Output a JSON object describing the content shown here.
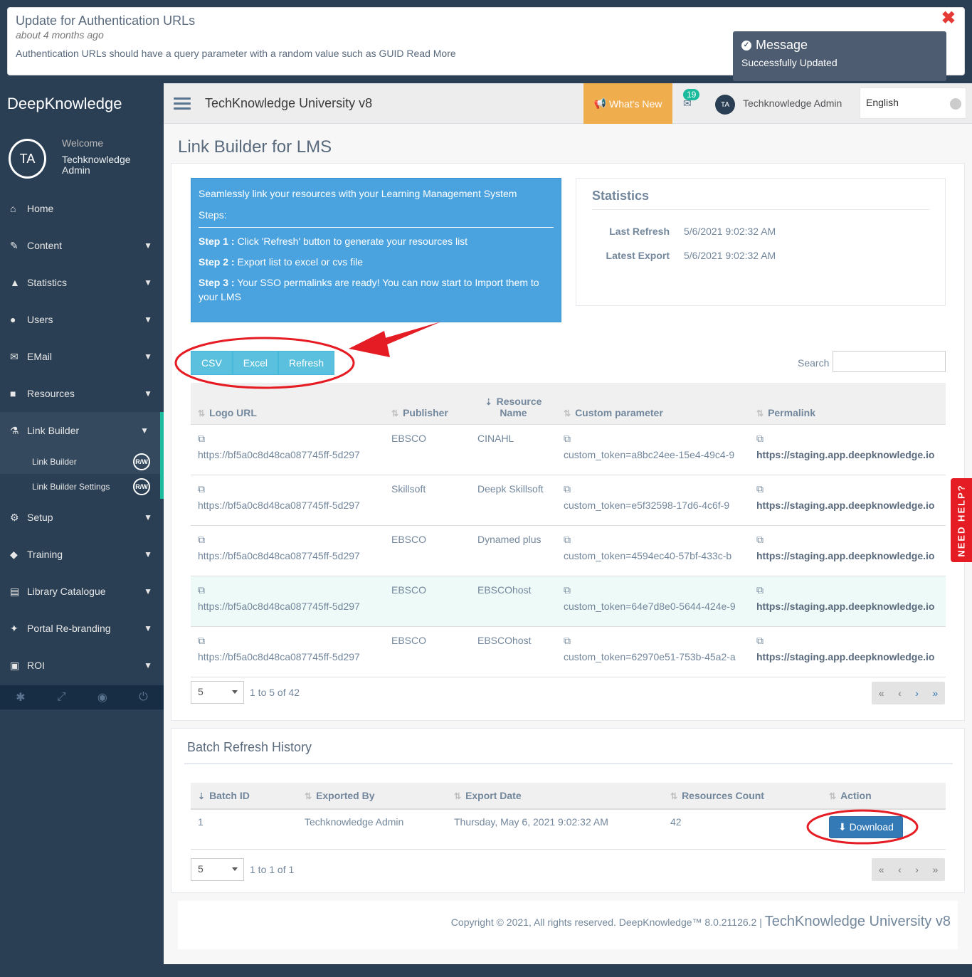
{
  "notification": {
    "title": "Update for Authentication URLs",
    "time": "about 4 months ago",
    "body": "Authentication URLs should have a query parameter with a random value such as GUID Read More"
  },
  "toast": {
    "title": "Message",
    "body": "Successfully Updated"
  },
  "sidebar": {
    "brand": "DeepKnowledge",
    "avatar": "TA",
    "welcome": "Welcome",
    "user_name": "Techknowledge Admin",
    "items": [
      {
        "label": "Home",
        "icon": "home-icon"
      },
      {
        "label": "Content",
        "icon": "edit-icon"
      },
      {
        "label": "Statistics",
        "icon": "area-chart-icon"
      },
      {
        "label": "Users",
        "icon": "users-icon"
      },
      {
        "label": "EMail",
        "icon": "envelope-icon"
      },
      {
        "label": "Resources",
        "icon": "sitemap-icon"
      },
      {
        "label": "Link Builder",
        "icon": "flask-icon"
      },
      {
        "label": "Setup",
        "icon": "cogs-icon"
      },
      {
        "label": "Training",
        "icon": "graduation-cap-icon"
      },
      {
        "label": "Library Catalogue",
        "icon": "book-icon"
      },
      {
        "label": "Portal Re-branding",
        "icon": "magic-icon"
      },
      {
        "label": "ROI",
        "icon": "money-icon"
      }
    ],
    "sub_items": [
      {
        "label": "Link Builder",
        "badge": "R/W"
      },
      {
        "label": "Link Builder Settings",
        "badge": "R/W"
      }
    ]
  },
  "topnav": {
    "title": "TechKnowledge University v8",
    "whats_new": "What's New",
    "mail_count": "19",
    "user_avatar": "TA",
    "user_name": "Techknowledge Admin",
    "language": "English"
  },
  "page": {
    "title": "Link Builder for LMS"
  },
  "infobox": {
    "intro": "Seamlessly link your resources with your Learning Management System",
    "steps_label": "Steps:",
    "step1_label": "Step 1 :",
    "step1": " Click 'Refresh' button to generate your resources list",
    "step2_label": "Step 2 :",
    "step2": " Export list to excel or cvs file",
    "step3_label": "Step 3 :",
    "step3": " Your SSO permalinks are ready! You can now start to Import them to your LMS"
  },
  "statistics": {
    "title": "Statistics",
    "last_refresh_label": "Last Refresh",
    "last_refresh": "5/6/2021 9:02:32 AM",
    "latest_export_label": "Latest Export",
    "latest_export": "5/6/2021 9:02:32 AM"
  },
  "toolbar": {
    "csv": "CSV",
    "excel": "Excel",
    "refresh": "Refresh",
    "search_label": "Search"
  },
  "links_table": {
    "columns": [
      "Logo URL",
      "Publisher",
      "Resource Name",
      "Custom parameter",
      "Permalink"
    ],
    "rows": [
      {
        "logo": "https://bf5a0c8d48ca087745ff-5d297",
        "publisher": "EBSCO",
        "name": "CINAHL",
        "param": "custom_token=a8bc24ee-15e4-49c4-9",
        "permalink": "https://staging.app.deepknowledge.io"
      },
      {
        "logo": "https://bf5a0c8d48ca087745ff-5d297",
        "publisher": "Skillsoft",
        "name": "Deepk Skillsoft",
        "param": "custom_token=e5f32598-17d6-4c6f-9",
        "permalink": "https://staging.app.deepknowledge.io"
      },
      {
        "logo": "https://bf5a0c8d48ca087745ff-5d297",
        "publisher": "EBSCO",
        "name": "Dynamed plus",
        "param": "custom_token=4594ec40-57bf-433c-b",
        "permalink": "https://staging.app.deepknowledge.io"
      },
      {
        "logo": "https://bf5a0c8d48ca087745ff-5d297",
        "publisher": "EBSCO",
        "name": "EBSCOhost",
        "param": "custom_token=64e7d8e0-5644-424e-9",
        "permalink": "https://staging.app.deepknowledge.io"
      },
      {
        "logo": "https://bf5a0c8d48ca087745ff-5d297",
        "publisher": "EBSCO",
        "name": "EBSCOhost",
        "param": "custom_token=62970e51-753b-45a2-a",
        "permalink": "https://staging.app.deepknowledge.io"
      }
    ],
    "page_size": "5",
    "page_info": "1 to 5 of 42"
  },
  "batch": {
    "title": "Batch Refresh History",
    "columns": [
      "Batch ID",
      "Exported By",
      "Export Date",
      "Resources Count",
      "Action"
    ],
    "rows": [
      {
        "id": "1",
        "by": "Techknowledge Admin",
        "date": "Thursday, May 6, 2021 9:02:32 AM",
        "count": "42",
        "action": "Download"
      }
    ],
    "page_size": "5",
    "page_info": "1 to 1 of 1"
  },
  "footer": {
    "copyright": "Copyright © 2021, All rights reserved. DeepKnowledge™ 8.0.21126.2 |",
    "site": "TechKnowledge University v8"
  },
  "need_help": "NEED HELP?",
  "colors": {
    "sidebar": "#2a3f54",
    "accent": "#1abb9c",
    "info": "#4aa3df",
    "button": "#5bc0de",
    "whats_new": "#f0ad4e",
    "annotation": "#e51c23"
  }
}
